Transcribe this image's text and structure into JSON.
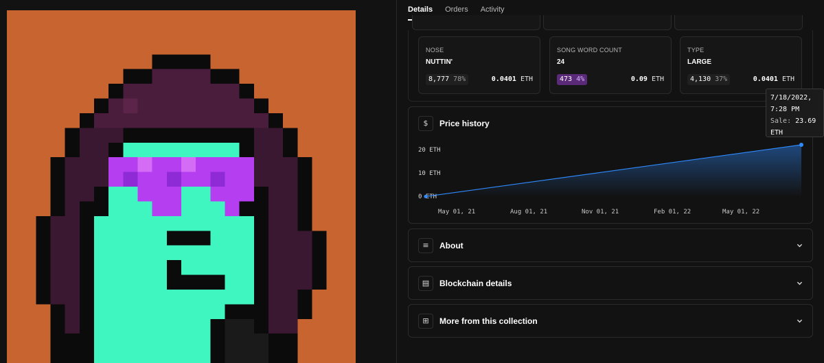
{
  "tabs": [
    {
      "label": "Details",
      "active": true
    },
    {
      "label": "Orders",
      "active": false
    },
    {
      "label": "Activity",
      "active": false
    }
  ],
  "traits": [
    {
      "label": "NOSE",
      "value": "NUTTIN'",
      "count": "8,777",
      "pct": "78%",
      "price": "0.0401",
      "unit": "ETH",
      "rare": false
    },
    {
      "label": "SONG WORD COUNT",
      "value": "24",
      "count": "473",
      "pct": "4%",
      "price": "0.09",
      "unit": "ETH",
      "rare": true
    },
    {
      "label": "TYPE",
      "value": "LARGE",
      "count": "4,130",
      "pct": "37%",
      "price": "0.0401",
      "unit": "ETH",
      "rare": false
    }
  ],
  "price_history": {
    "icon": "dollar-icon",
    "icon_glyph": "$",
    "title": "Price history",
    "tooltip": {
      "date": "7/18/2022,",
      "time": "7:28 PM",
      "sale_label": "Sale:",
      "sale_value": "23.69",
      "unit": "ETH"
    }
  },
  "chart_data": {
    "type": "area",
    "x": [
      "2021-03-10",
      "2022-07-18"
    ],
    "values": [
      0.2,
      23.69
    ],
    "x_ticks": [
      "May 01, 21",
      "Aug 01, 21",
      "Nov 01, 21",
      "Feb 01, 22",
      "May 01, 22"
    ],
    "y_ticks": [
      "20 ETH",
      "10 ETH",
      "0 ETH"
    ],
    "ylim": [
      0,
      23.69
    ],
    "line_color": "#2f8bff"
  },
  "sections": [
    {
      "icon": "document-lines-icon",
      "icon_glyph": "≡",
      "title": "About"
    },
    {
      "icon": "blockchain-card-icon",
      "icon_glyph": "▤",
      "title": "Blockchain details"
    },
    {
      "icon": "grid-icon",
      "icon_glyph": "⊞",
      "title": "More from this collection"
    }
  ],
  "colors": {
    "accent": "#2f8bff",
    "nft_background": "#c8642f",
    "rare_badge": "#5a2a78"
  }
}
